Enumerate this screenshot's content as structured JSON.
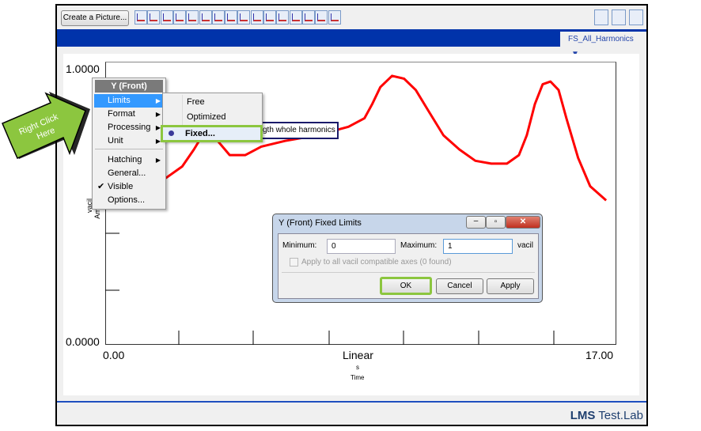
{
  "toolbar": {
    "create_picture": "Create a Picture...",
    "icons": [
      "line-display-icon",
      "overlay-display-icon",
      "stacked-display-icon",
      "front-back-icon",
      "nyquist-icon",
      "polar-icon",
      "scatter-icon",
      "bar-icon",
      "colormap-icon",
      "waterfall-icon",
      "campbell-icon",
      "geometry-icon",
      "numeric-icon",
      "table-icon",
      "axes-icon",
      "blank-icon"
    ],
    "right_icons": [
      "forward-icon",
      "new-picture-icon",
      "edit-icon"
    ]
  },
  "tab": {
    "label": "FS_All_Harmonics"
  },
  "plot": {
    "y_max": "1.0000",
    "y_min": "0.0000",
    "x_min": "0.00",
    "x_max": "17.00",
    "x_scale": "Linear",
    "x_unit": "s",
    "x_label": "Time",
    "y_unit": "vacil",
    "y_label_partial": "Am",
    "legend_partial": "gth whole harmonics",
    "line_color": "#ff0000",
    "curve": [
      [
        1.37,
        0.57
      ],
      [
        2.03,
        0.59
      ],
      [
        2.56,
        0.63
      ],
      [
        2.95,
        0.69
      ],
      [
        3.35,
        0.76
      ],
      [
        3.74,
        0.72
      ],
      [
        4.14,
        0.67
      ],
      [
        4.66,
        0.67
      ],
      [
        5.19,
        0.7
      ],
      [
        5.98,
        0.72
      ],
      [
        7.04,
        0.74
      ],
      [
        8.09,
        0.77
      ],
      [
        8.62,
        0.8
      ],
      [
        8.88,
        0.85
      ],
      [
        9.15,
        0.91
      ],
      [
        9.54,
        0.95
      ],
      [
        9.94,
        0.94
      ],
      [
        10.33,
        0.9
      ],
      [
        10.73,
        0.83
      ],
      [
        11.25,
        0.74
      ],
      [
        11.78,
        0.69
      ],
      [
        12.31,
        0.65
      ],
      [
        12.84,
        0.64
      ],
      [
        13.36,
        0.64
      ],
      [
        13.76,
        0.67
      ],
      [
        14.02,
        0.74
      ],
      [
        14.29,
        0.85
      ],
      [
        14.55,
        0.92
      ],
      [
        14.81,
        0.93
      ],
      [
        15.08,
        0.9
      ],
      [
        15.34,
        0.8
      ],
      [
        15.73,
        0.66
      ],
      [
        16.13,
        0.56
      ],
      [
        16.66,
        0.51
      ]
    ]
  },
  "context_menu": {
    "title": "Y (Front)",
    "items": [
      {
        "label": "Limits",
        "submenu": true
      },
      {
        "label": "Format",
        "submenu": true
      },
      {
        "label": "Processing",
        "submenu": true
      },
      {
        "label": "Unit",
        "submenu": true
      },
      {
        "label": "Hatching",
        "submenu": true
      },
      {
        "label": "General..."
      },
      {
        "label": "Visible",
        "checked": true
      },
      {
        "label": "Options..."
      }
    ]
  },
  "submenu": {
    "items": [
      "Free",
      "Optimized",
      "Fixed..."
    ],
    "selected": "Fixed..."
  },
  "annotation": {
    "text": "Right Click Here",
    "color": "#8cc63f"
  },
  "dialog": {
    "title": "Y (Front) Fixed Limits",
    "min_label": "Minimum:",
    "min_value": "0",
    "max_label": "Maximum:",
    "max_value": "1",
    "unit": "vacil",
    "apply_all": "Apply to all vacil compatible axes (0 found)",
    "apply_all_checked": false,
    "ok": "OK",
    "cancel": "Cancel",
    "apply": "Apply"
  },
  "footer": {
    "brand_bold": "LMS",
    "brand_rest": " Test.Lab"
  }
}
